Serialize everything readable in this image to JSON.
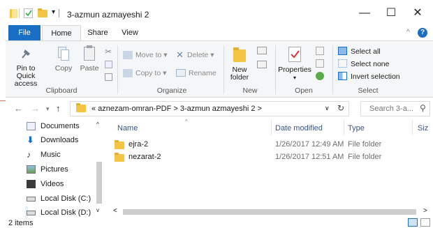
{
  "window": {
    "title": "3-azmun azmayeshi 2",
    "minimize": "—",
    "maximize": "☐",
    "close": "✕"
  },
  "ribbon_tabs": {
    "file": "File",
    "home": "Home",
    "share": "Share",
    "view": "View"
  },
  "clipboard": {
    "pin": "Pin to Quick access",
    "copy": "Copy",
    "paste": "Paste",
    "label": "Clipboard"
  },
  "organize": {
    "move_to": "Move to",
    "copy_to": "Copy to",
    "delete": "Delete",
    "rename": "Rename",
    "label": "Organize"
  },
  "new": {
    "new_folder": "New folder",
    "label": "New"
  },
  "open": {
    "properties": "Properties",
    "label": "Open"
  },
  "select": {
    "select_all": "Select all",
    "select_none": "Select none",
    "invert": "Invert selection",
    "label": "Select"
  },
  "address": {
    "path": "«  aznezam-omran-PDF  >  3-azmun azmayeshi 2  >",
    "search_placeholder": "Search 3-a..."
  },
  "nav_pane": [
    {
      "label": "Documents",
      "icon": "documents-icon"
    },
    {
      "label": "Downloads",
      "icon": "downloads-icon"
    },
    {
      "label": "Music",
      "icon": "music-icon"
    },
    {
      "label": "Pictures",
      "icon": "pictures-icon"
    },
    {
      "label": "Videos",
      "icon": "videos-icon"
    },
    {
      "label": "Local Disk (C:)",
      "icon": "drive-icon"
    },
    {
      "label": "Local Disk (D:)",
      "icon": "drive-icon"
    }
  ],
  "columns": {
    "name": "Name",
    "date": "Date modified",
    "type": "Type",
    "size": "Siz"
  },
  "files": [
    {
      "name": "ejra-2",
      "date": "1/26/2017 12:49 AM",
      "type": "File folder"
    },
    {
      "name": "nezarat-2",
      "date": "1/26/2017 12:51 AM",
      "type": "File folder"
    }
  ],
  "status": {
    "count": "2 items"
  },
  "colors": {
    "accent": "#1a6fc4",
    "folder": "#f4c542",
    "column_header": "#3b5480"
  }
}
